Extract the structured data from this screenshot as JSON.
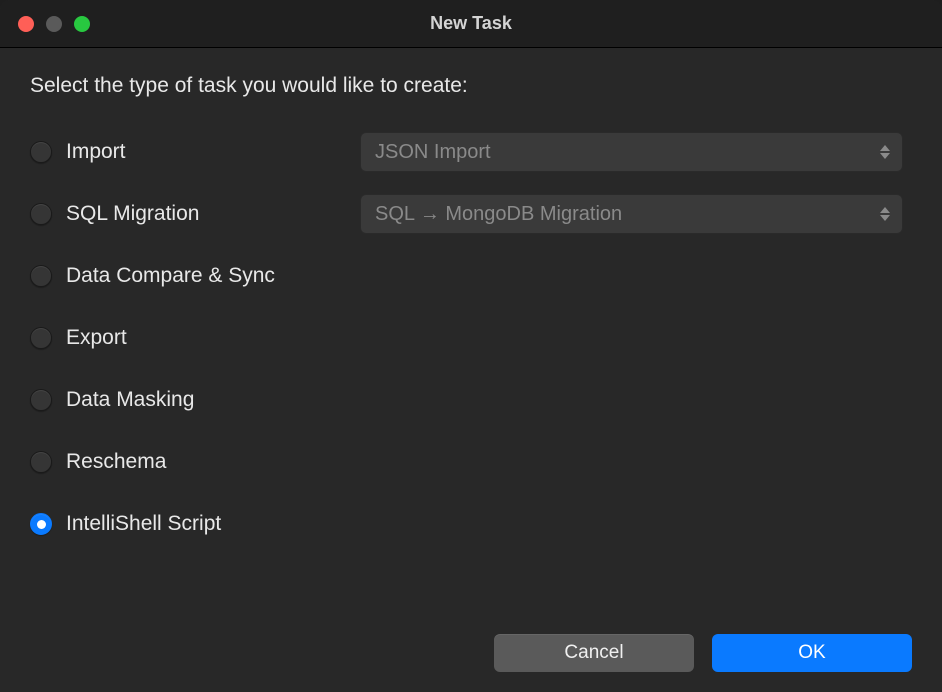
{
  "window": {
    "title": "New Task"
  },
  "prompt": "Select the type of task you would like to create:",
  "options": [
    {
      "label": "Import",
      "selected": false,
      "hasDropdown": true,
      "dropdownValue": "JSON Import"
    },
    {
      "label": "SQL Migration",
      "selected": false,
      "hasDropdown": true,
      "dropdownValue": "SQL → MongoDB Migration"
    },
    {
      "label": "Data Compare & Sync",
      "selected": false,
      "hasDropdown": false
    },
    {
      "label": "Export",
      "selected": false,
      "hasDropdown": false
    },
    {
      "label": "Data Masking",
      "selected": false,
      "hasDropdown": false
    },
    {
      "label": "Reschema",
      "selected": false,
      "hasDropdown": false
    },
    {
      "label": "IntelliShell Script",
      "selected": true,
      "hasDropdown": false
    }
  ],
  "buttons": {
    "cancel": "Cancel",
    "ok": "OK"
  }
}
